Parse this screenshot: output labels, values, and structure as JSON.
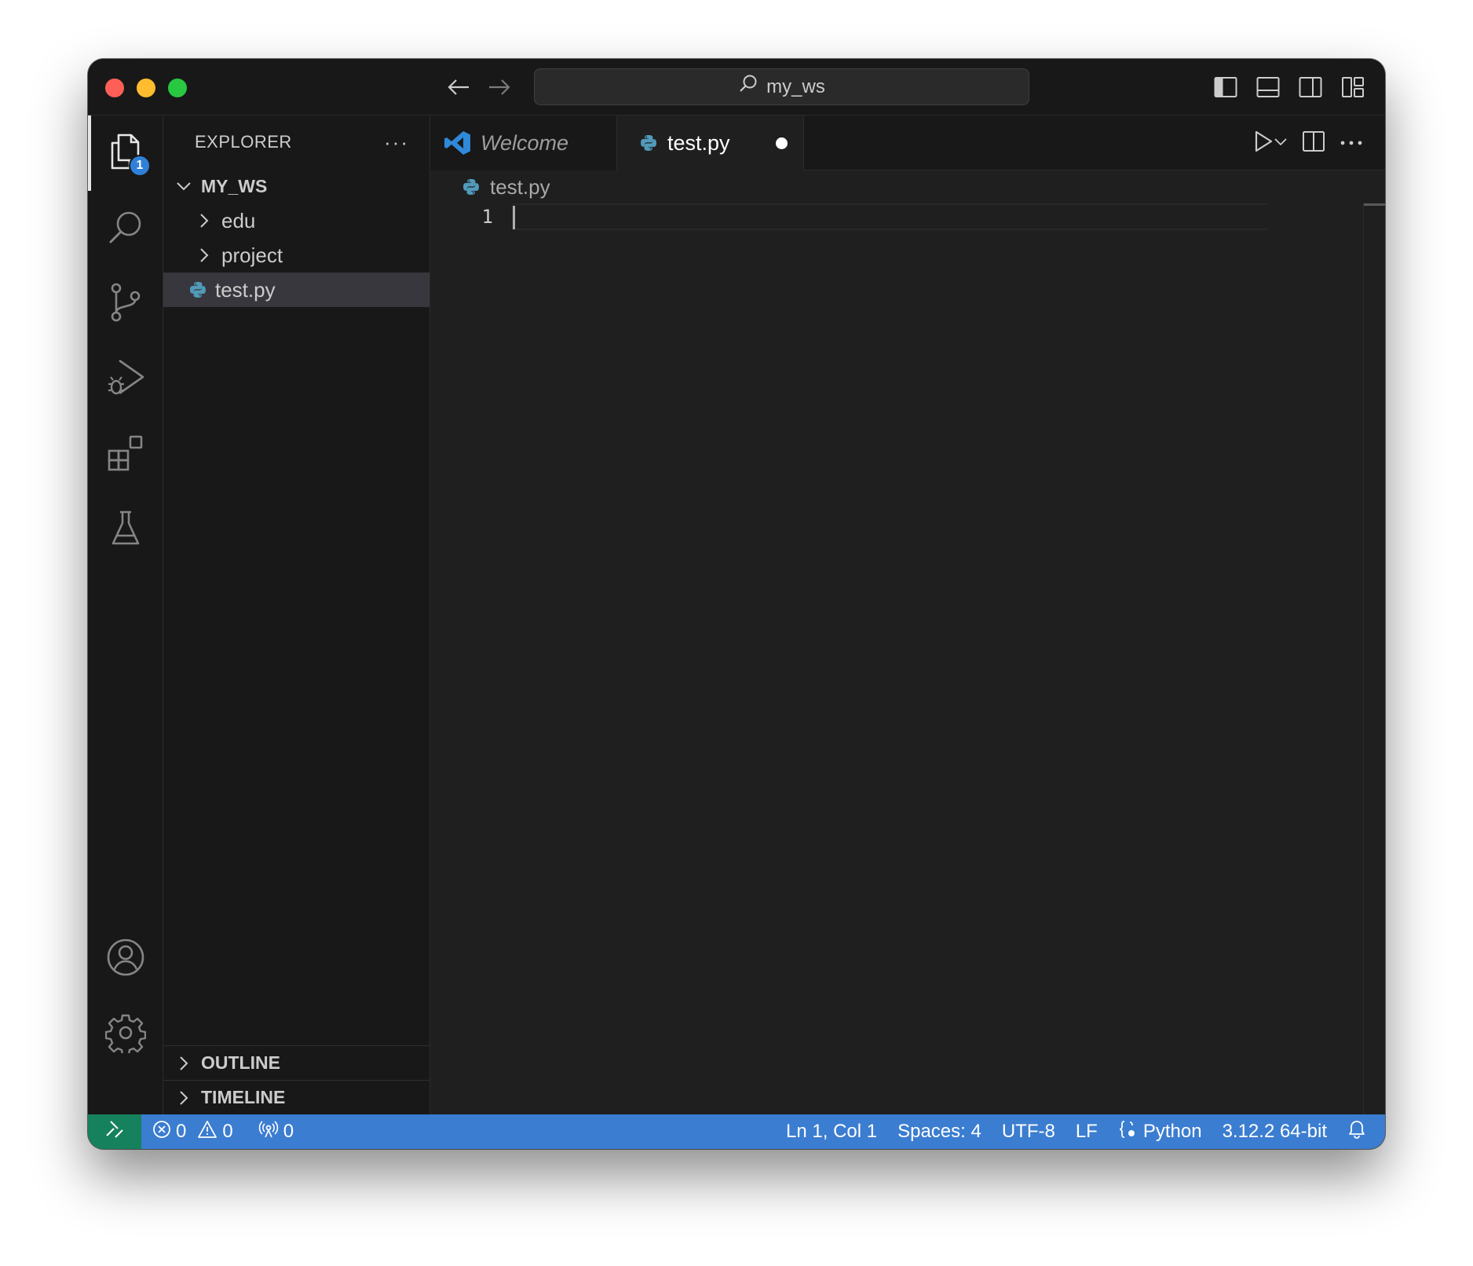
{
  "titlebar": {
    "search_text": "my_ws",
    "icons": [
      "back-arrow-icon",
      "forward-arrow-icon",
      "search-icon",
      "toggle-primary-sidebar-icon",
      "toggle-panel-icon",
      "toggle-secondary-sidebar-icon",
      "customize-layout-icon"
    ]
  },
  "activitybar": {
    "explorer_badge": "1",
    "items": [
      "files-icon",
      "search-icon",
      "source-control-icon",
      "run-debug-icon",
      "extensions-icon",
      "testing-icon",
      "account-icon",
      "settings-gear-icon"
    ]
  },
  "sidebar": {
    "title": "EXPLORER",
    "more": "···",
    "workspace": "MY_WS",
    "items": [
      {
        "label": "edu",
        "type": "folder"
      },
      {
        "label": "project",
        "type": "folder"
      },
      {
        "label": "test.py",
        "type": "file",
        "selected": true
      }
    ],
    "sections": [
      "OUTLINE",
      "TIMELINE"
    ]
  },
  "tabs": [
    {
      "label": "Welcome",
      "active": false
    },
    {
      "label": "test.py",
      "active": true,
      "dirty": true
    }
  ],
  "editor": {
    "breadcrumb": "test.py",
    "lines": [
      {
        "number": "1",
        "text": ""
      }
    ]
  },
  "statusbar": {
    "errors": "0",
    "warnings": "0",
    "ports": "0",
    "position": "Ln 1, Col 1",
    "spaces": "Spaces: 4",
    "encoding": "UTF-8",
    "eol": "LF",
    "language": "Python",
    "interpreter": "3.12.2 64-bit"
  },
  "colors": {
    "accent": "#3b7dd0",
    "remote": "#16825d",
    "python_icon": "#519aba",
    "vscode_logo": "#2f88d8"
  }
}
